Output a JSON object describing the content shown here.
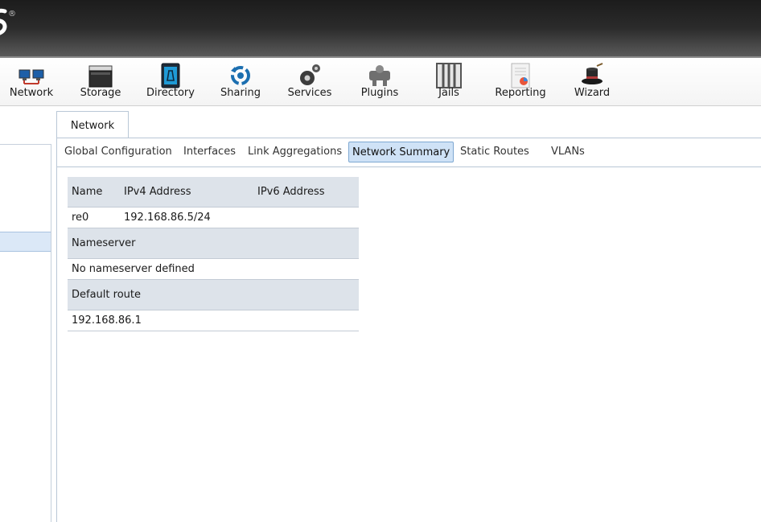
{
  "header": {
    "registered_mark": "®"
  },
  "toolbar": {
    "items": [
      {
        "label": "Network",
        "icon": "network-icon"
      },
      {
        "label": "Storage",
        "icon": "storage-icon"
      },
      {
        "label": "Directory",
        "icon": "directory-icon"
      },
      {
        "label": "Sharing",
        "icon": "sharing-icon"
      },
      {
        "label": "Services",
        "icon": "services-icon"
      },
      {
        "label": "Plugins",
        "icon": "plugins-icon"
      },
      {
        "label": "Jails",
        "icon": "jails-icon"
      },
      {
        "label": "Reporting",
        "icon": "reporting-icon"
      },
      {
        "label": "Wizard",
        "icon": "wizard-icon"
      }
    ]
  },
  "main": {
    "tab_label": "Network",
    "subtabs": [
      {
        "label": "Global Configuration",
        "active": false
      },
      {
        "label": "Interfaces",
        "active": false
      },
      {
        "label": "Link Aggregations",
        "active": false
      },
      {
        "label": "Network Summary",
        "active": true
      },
      {
        "label": "Static Routes",
        "active": false
      },
      {
        "label": "VLANs",
        "active": false
      }
    ]
  },
  "summary": {
    "columns": [
      "Name",
      "IPv4 Address",
      "IPv6 Address"
    ],
    "interfaces": [
      {
        "name": "re0",
        "ipv4": "192.168.86.5/24",
        "ipv6": ""
      }
    ],
    "nameserver_header": "Nameserver",
    "nameserver_value": "No nameserver defined",
    "default_route_header": "Default route",
    "default_route_value": "192.168.86.1"
  },
  "colors": {
    "header_dark": "#1c1c1c",
    "active_tab_bg": "#cfe2f6",
    "table_header_bg": "#dde3ea",
    "panel_border": "#b9c7d6"
  }
}
